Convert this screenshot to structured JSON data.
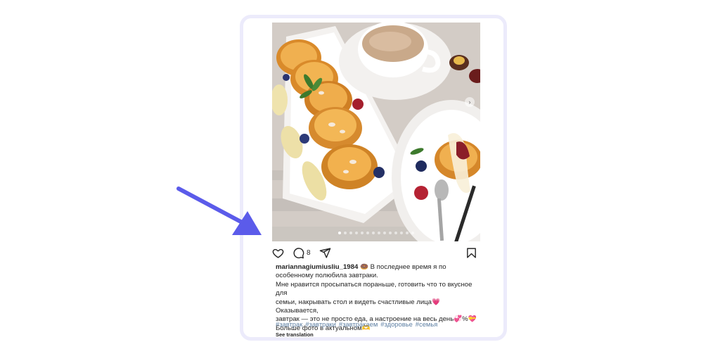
{
  "post": {
    "username": "mariannagiumiusliu_1984",
    "comment_count": "8",
    "caption_lines": [
      "🍩 В последнее время я по особенному полюбила завтраки.",
      "Мне нравится просыпаться пораньше, готовить что то вкусное для",
      "семьи, накрывать стол и видеть счастливые лица💗 Оказывается,",
      "завтрак — это не просто еда, а настроение на весь день💞%💝",
      "Больше фото в актуальном🫶"
    ],
    "hashtags": [
      "#завтрак",
      "#завтраки",
      "#завтракаем",
      "#здоровье",
      "#семья"
    ],
    "see_translation": "See translation",
    "carousel_next": "›",
    "carousel_total": 14,
    "carousel_index": 1
  },
  "icons": {
    "like": "heart-icon",
    "comment": "comment-icon",
    "share": "send-icon",
    "save": "bookmark-icon",
    "annotation": "arrow-pointer-icon"
  },
  "colors": {
    "frame": "#ecebfb",
    "hashtag": "#5d7fa3",
    "arrow": "#5b5bea",
    "heart_emoji": "#e8436a"
  }
}
